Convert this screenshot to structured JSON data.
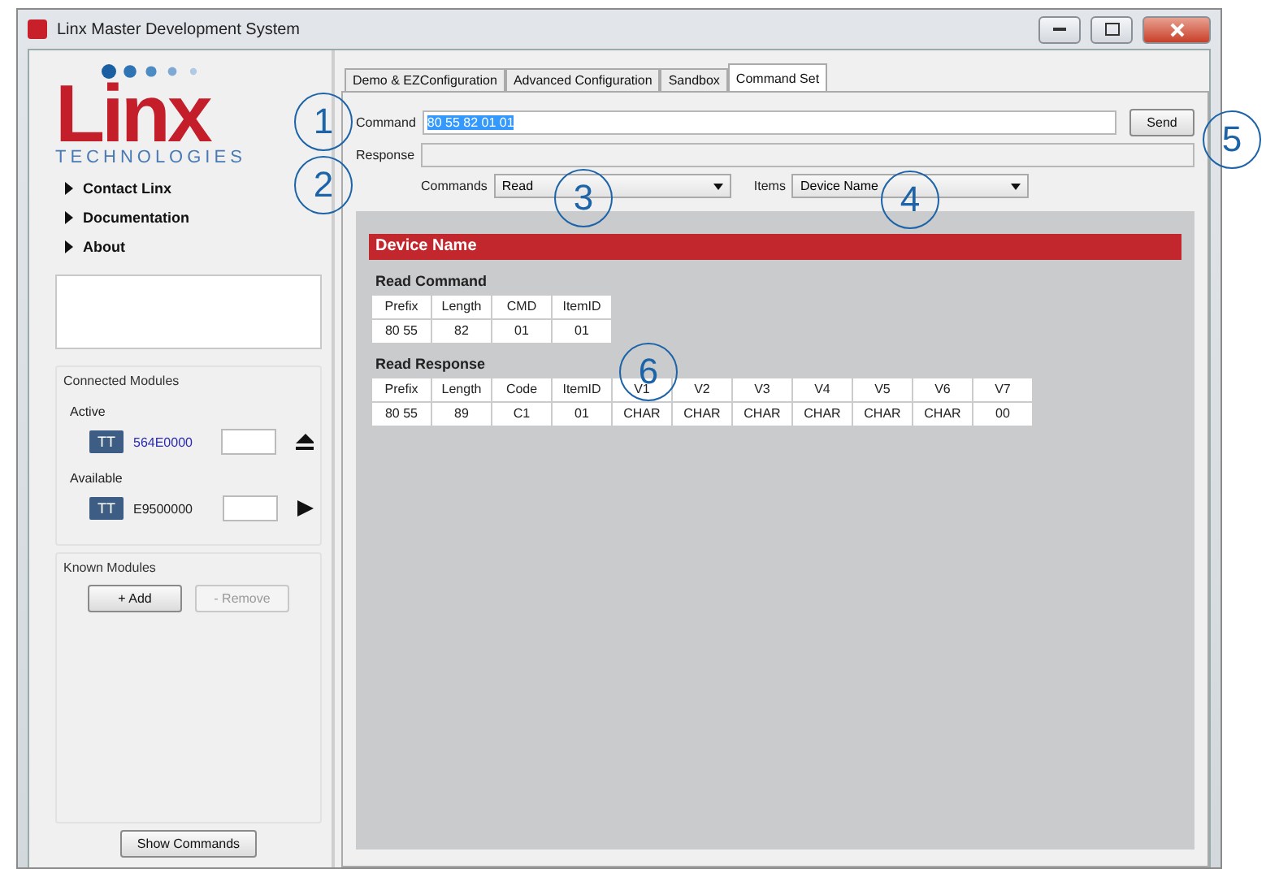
{
  "window": {
    "title": "Linx Master Development System"
  },
  "logo": {
    "name": "Linx",
    "tagline": "TECHNOLOGIES"
  },
  "sidebar": {
    "links": [
      "Contact Linx",
      "Documentation",
      "About"
    ],
    "connected_modules": {
      "title": "Connected Modules",
      "groups": [
        {
          "label": "Active",
          "kind": "active",
          "badge": "TT",
          "id": "564E0000"
        },
        {
          "label": "Available",
          "kind": "available",
          "badge": "TT",
          "id": "E9500000"
        }
      ]
    },
    "known_modules": {
      "title": "Known Modules",
      "buttons": [
        {
          "label": "+ Add",
          "disabled": false
        },
        {
          "label": "- Remove",
          "disabled": true
        }
      ]
    },
    "show_commands": "Show Commands"
  },
  "tabs": [
    {
      "label": "Demo & EZConfiguration",
      "selected": false
    },
    {
      "label": "Advanced Configuration",
      "selected": false
    },
    {
      "label": "Sandbox",
      "selected": false
    },
    {
      "label": "Command Set",
      "selected": true
    }
  ],
  "command": {
    "label": "Command",
    "value": "80 55 82 01 01",
    "selected": true,
    "button": "Send"
  },
  "response": {
    "label": "Response"
  },
  "commands_select": {
    "label": "Commands",
    "value": "Read"
  },
  "items_select": {
    "label": "Items",
    "value": "Device Name"
  },
  "panel": {
    "title": "Device Name",
    "sections": [
      {
        "title": "Read Command",
        "columns": [
          "Prefix",
          "Length",
          "CMD",
          "ItemID"
        ],
        "rows": [
          [
            "80 55",
            "82",
            "01",
            "01"
          ]
        ]
      },
      {
        "title": "Read Response",
        "columns": [
          "Prefix",
          "Length",
          "Code",
          "ItemID",
          "V1",
          "V2",
          "V3",
          "V4",
          "V5",
          "V6",
          "V7"
        ],
        "rows": [
          [
            "80 55",
            "89",
            "C1",
            "01",
            "CHAR",
            "CHAR",
            "CHAR",
            "CHAR",
            "CHAR",
            "CHAR",
            "00"
          ]
        ]
      }
    ]
  },
  "callouts": [
    "1",
    "2",
    "3",
    "4",
    "5",
    "6"
  ]
}
